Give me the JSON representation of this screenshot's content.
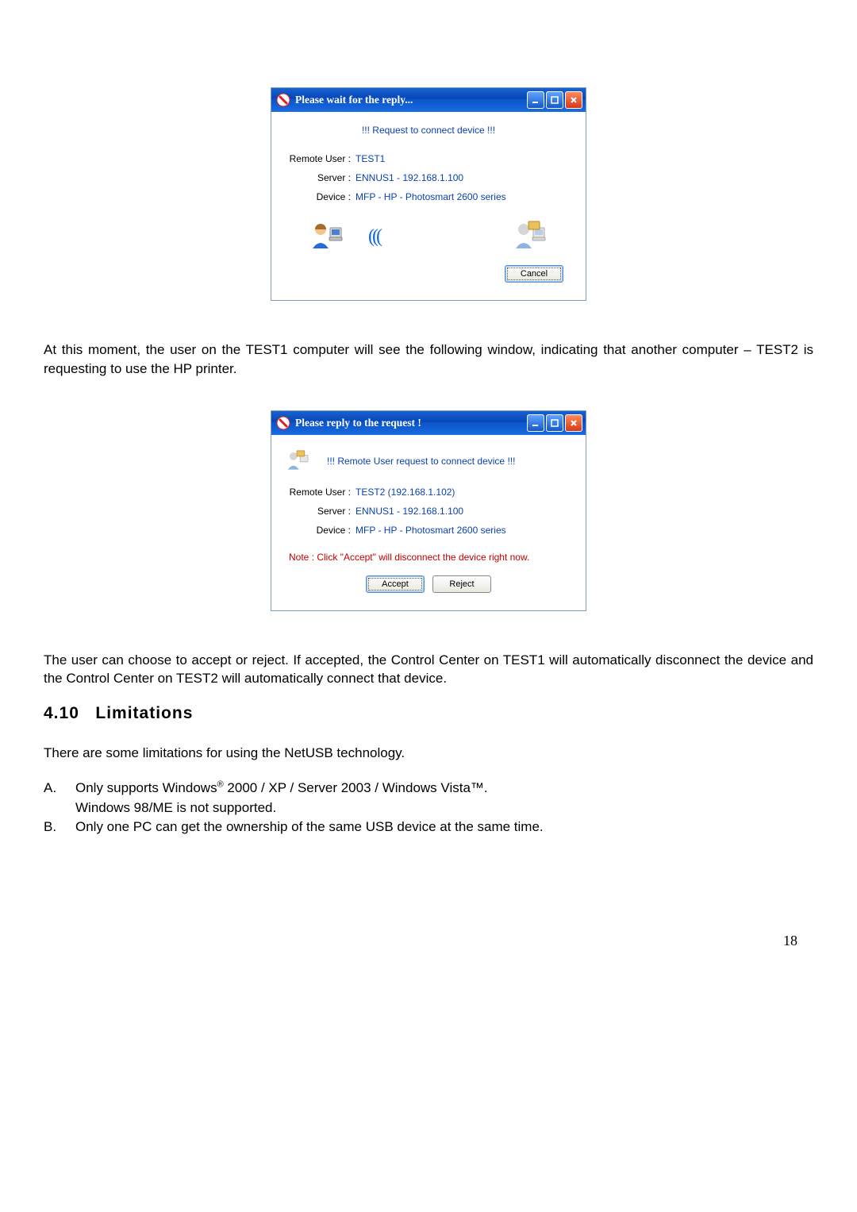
{
  "dialog1": {
    "title": "Please wait for the reply...",
    "header": "!!! Request to connect device !!!",
    "remote_user_label": "Remote User :",
    "remote_user_value": "TEST1",
    "server_label": "Server :",
    "server_value": "ENNUS1 - 192.168.1.100",
    "device_label": "Device :",
    "device_value": "MFP - HP - Photosmart 2600 series",
    "cancel_label": "Cancel"
  },
  "para1": "At this moment, the user on the TEST1 computer will see the following window, indicating that another computer – TEST2 is requesting to use the HP printer.",
  "dialog2": {
    "title": "Please reply to the request !",
    "header": "!!! Remote User request to connect device !!!",
    "remote_user_label": "Remote User :",
    "remote_user_value": "TEST2 (192.168.1.102)",
    "server_label": "Server :",
    "server_value": "ENNUS1 - 192.168.1.100",
    "device_label": "Device :",
    "device_value": "MFP - HP - Photosmart 2600 series",
    "note": "Note : Click \"Accept\" will disconnect the device right now.",
    "accept_label": "Accept",
    "reject_label": "Reject"
  },
  "para2": "The user can choose to accept or reject. If accepted, the Control Center on TEST1 will automatically disconnect the device and the Control Center on TEST2 will automatically connect that device.",
  "section": {
    "number": "4.10",
    "title": "Limitations"
  },
  "para3": "There are some limitations for using the NetUSB technology.",
  "listA_marker": "A.",
  "listA_line1a": "Only supports Windows",
  "listA_sup": "®",
  "listA_line1b": " 2000 / XP / Server 2003 / Windows Vista™.",
  "listA_line2": "Windows 98/ME is not supported.",
  "listB_marker": "B.",
  "listB": "Only one PC can get the ownership of the same USB device at the same time.",
  "page_number": "18"
}
